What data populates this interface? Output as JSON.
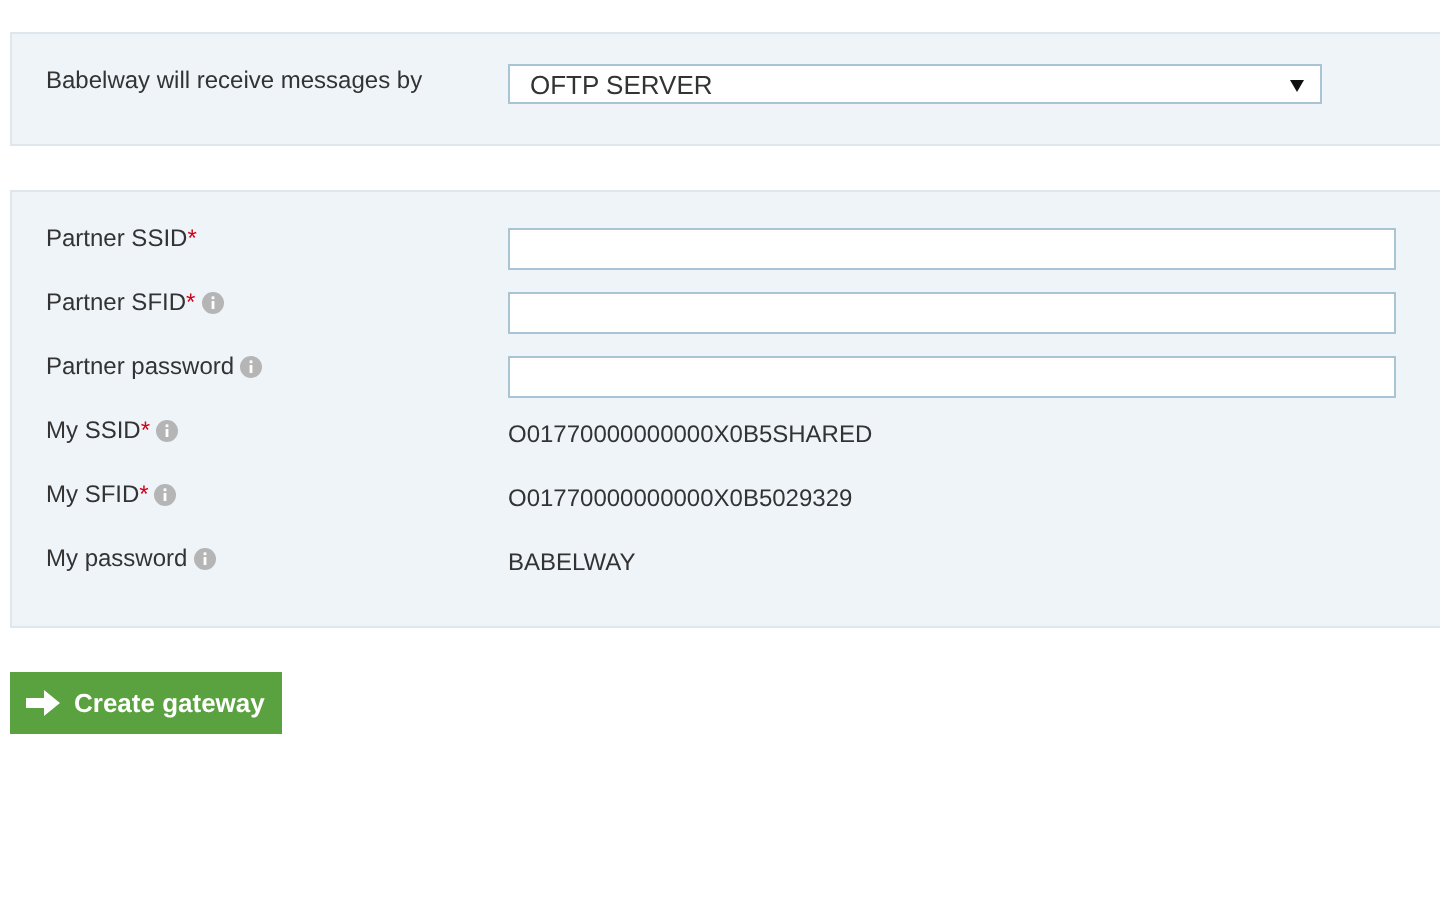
{
  "receive": {
    "label": "Babelway will receive messages by",
    "value": "OFTP SERVER"
  },
  "fields": [
    {
      "kind": "input",
      "label": "Partner SSID",
      "mark": "*",
      "info": false
    },
    {
      "kind": "input",
      "label": "Partner SFID",
      "mark": "*",
      "info": true
    },
    {
      "kind": "input",
      "label": "Partner password",
      "info": true
    },
    {
      "kind": "text",
      "label": "My SSID",
      "mark": "*",
      "info": true,
      "value": "O01770000000000X0B5SHARED"
    },
    {
      "kind": "text",
      "label": "My SFID",
      "mark": "*",
      "info": true,
      "value": "O01770000000000X0B5029329"
    },
    {
      "kind": "text",
      "label": "My password",
      "info": true,
      "value": "BABELWAY"
    }
  ],
  "button": {
    "label": "Create gateway"
  }
}
